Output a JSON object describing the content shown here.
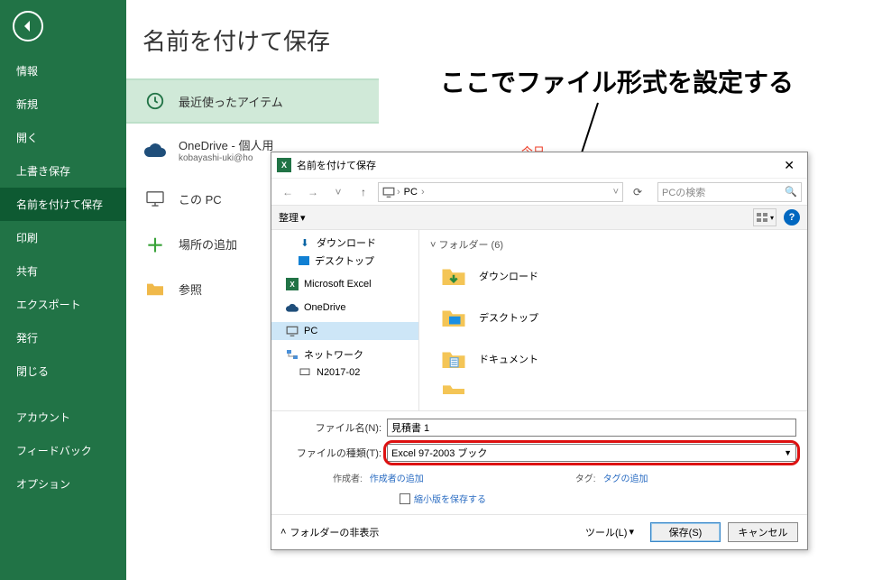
{
  "sidebar": {
    "items": [
      {
        "label": "情報"
      },
      {
        "label": "新規"
      },
      {
        "label": "開く"
      },
      {
        "label": "上書き保存"
      },
      {
        "label": "名前を付けて保存"
      },
      {
        "label": "印刷"
      },
      {
        "label": "共有"
      },
      {
        "label": "エクスポート"
      },
      {
        "label": "発行"
      },
      {
        "label": "閉じる"
      }
    ],
    "bottom": [
      {
        "label": "アカウント"
      },
      {
        "label": "フィードバック"
      },
      {
        "label": "オプション"
      }
    ]
  },
  "page": {
    "title": "名前を付けて保存",
    "locations": {
      "recent": "最近使ったアイテム",
      "onedrive_title": "OneDrive - 個人用",
      "onedrive_sub": "kobayashi-uki@ho",
      "this_pc": "この PC",
      "add_place": "場所の追加",
      "browse": "参照",
      "today": "今日"
    }
  },
  "annotation": {
    "text": "ここでファイル形式を設定する"
  },
  "dialog": {
    "title": "名前を付けて保存",
    "breadcrumb": {
      "icon": "pc",
      "segs": [
        "PC"
      ]
    },
    "search_placeholder": "PCの検索",
    "organize": "整理",
    "tree": [
      {
        "icon": "dl",
        "label": "ダウンロード",
        "indent": 1
      },
      {
        "icon": "desk",
        "label": "デスクトップ",
        "indent": 1
      },
      {
        "icon": "excel",
        "label": "Microsoft Excel",
        "indent": 0
      },
      {
        "icon": "od",
        "label": "OneDrive",
        "indent": 0
      },
      {
        "icon": "pc",
        "label": "PC",
        "indent": 0,
        "selected": true
      },
      {
        "icon": "net",
        "label": "ネットワーク",
        "indent": 0
      },
      {
        "icon": "pcnode",
        "label": "N2017-02",
        "indent": 1
      }
    ],
    "folder_header": "フォルダー (6)",
    "folders": [
      {
        "icon": "dl",
        "label": "ダウンロード"
      },
      {
        "icon": "desk",
        "label": "デスクトップ"
      },
      {
        "icon": "doc",
        "label": "ドキュメント"
      }
    ],
    "filename_label": "ファイル名(N):",
    "filename_value": "見積書 1",
    "filetype_label": "ファイルの種類(T):",
    "filetype_value": "Excel 97-2003 ブック",
    "author_label": "作成者:",
    "author_link": "作成者の追加",
    "tag_label": "タグ:",
    "tag_link": "タグの追加",
    "thumb_label": "縮小版を保存する",
    "hide_folders": "フォルダーの非表示",
    "tools": "ツール(L)",
    "save": "保存(S)",
    "cancel": "キャンセル"
  }
}
